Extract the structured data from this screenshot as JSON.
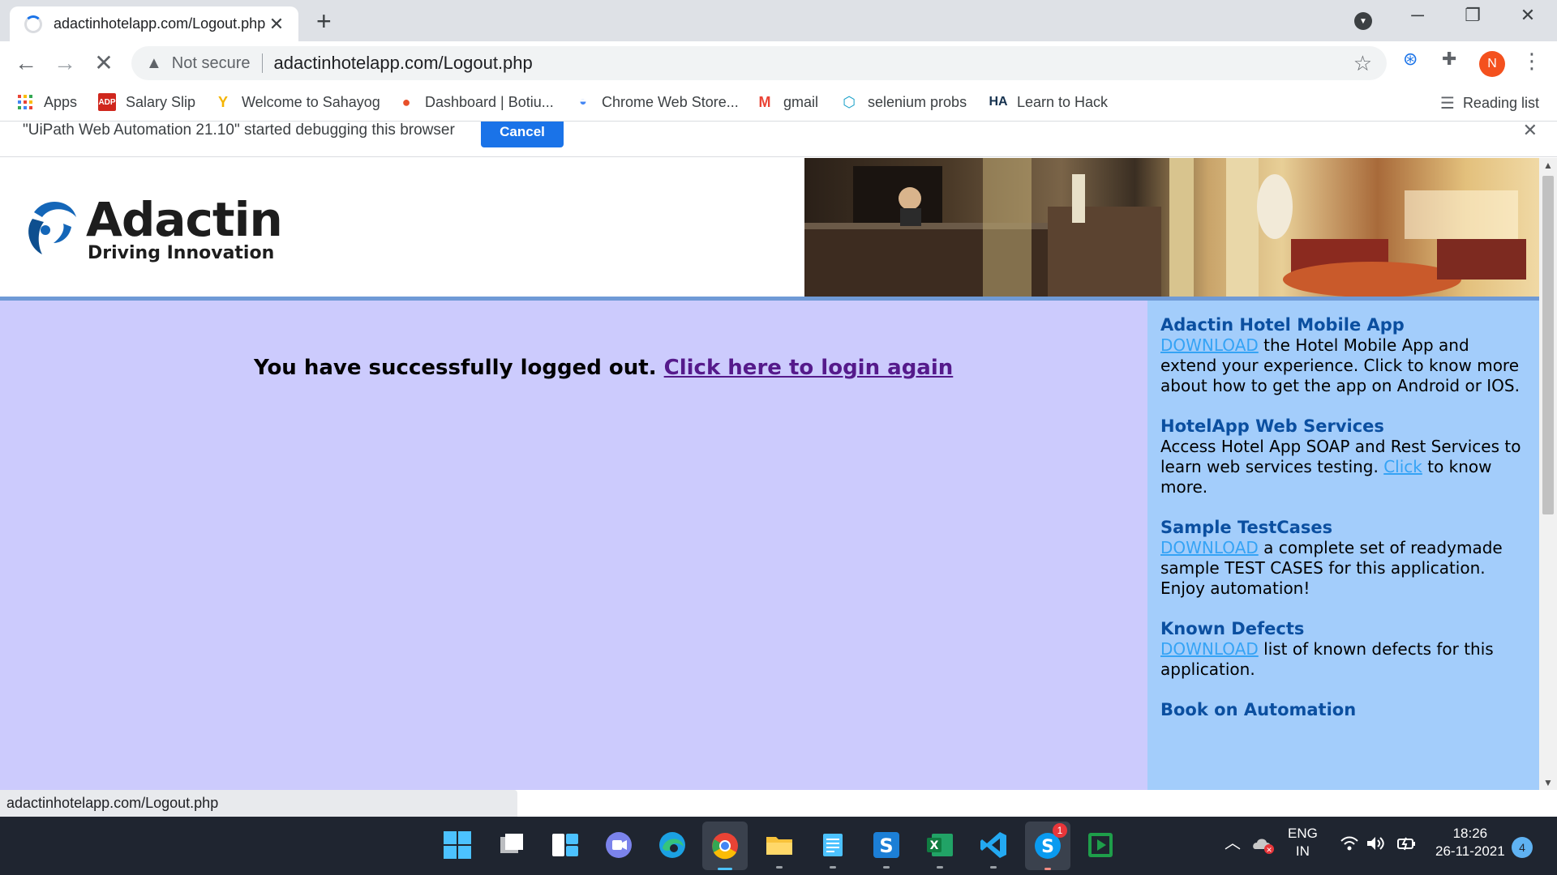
{
  "browser": {
    "tab_title": "adactinhotelapp.com/Logout.php",
    "tab_close": "✕",
    "new_tab": "+",
    "security_label": "Not secure",
    "url": "adactinhotelapp.com/Logout.php",
    "profile_initial": "N"
  },
  "bookmarks": [
    {
      "label": "Apps",
      "icon": "apps-grid-icon"
    },
    {
      "label": "Salary Slip",
      "icon": "adp-icon"
    },
    {
      "label": "Welcome to Sahayog",
      "icon": "sahayog-icon"
    },
    {
      "label": "Dashboard | Botiu...",
      "icon": "dashboard-icon"
    },
    {
      "label": "Chrome Web Store...",
      "icon": "webstore-icon"
    },
    {
      "label": "gmail",
      "icon": "gmail-icon"
    },
    {
      "label": "selenium probs",
      "icon": "selenium-icon"
    },
    {
      "label": "Learn to Hack",
      "icon": "hack-icon"
    }
  ],
  "reading_list": "Reading list",
  "infobar": {
    "message": "\"UiPath Web Automation 21.10\" started debugging this browser",
    "cancel_label": "Cancel"
  },
  "site": {
    "logo_name": "Adactin",
    "logo_tagline": "Driving Innovation",
    "logout_message": "You have successfully logged out.",
    "login_link": "Click here to login again"
  },
  "sidebar": {
    "mobile_title": "Adactin Hotel Mobile App",
    "mobile_link": "DOWNLOAD",
    "mobile_text": " the Hotel Mobile App and extend your experience. Click to know more about how to get the app on Android or IOS.",
    "ws_title": "HotelApp Web Services",
    "ws_text_before": "Access Hotel App SOAP and Rest Services to learn web services testing. ",
    "ws_link": "Click",
    "ws_text_after": " to know more.",
    "tc_title": "Sample TestCases",
    "tc_link": "DOWNLOAD",
    "tc_text": " a complete set of readymade sample TEST CASES for this application. Enjoy automation!",
    "kd_title": "Known Defects",
    "kd_link": "DOWNLOAD",
    "kd_text": " list of known defects for this application.",
    "book_title": "Book on Automation"
  },
  "status_url": "adactinhotelapp.com/Logout.php",
  "tray": {
    "lang_line1": "ENG",
    "lang_line2": "IN",
    "time": "18:26",
    "date": "26-11-2021",
    "notifications": "4",
    "skype_badge": "1"
  },
  "colors": {
    "main_bg": "#cccbfd",
    "sidebar_bg": "#a3cdfb",
    "sidebar_title": "#0b4fa0",
    "sidebar_link": "#35a3f5",
    "visited_link": "#551a8b",
    "cancel_button": "#1a73e8",
    "divider": "#6f9ad6"
  }
}
